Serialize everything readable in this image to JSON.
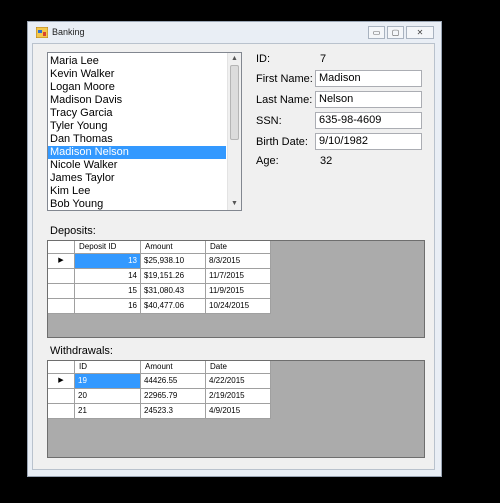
{
  "window": {
    "title": "Banking",
    "minimize": "▭",
    "maximize": "▢",
    "close": "✕"
  },
  "customers": {
    "items": [
      "Maria Lee",
      "Kevin Walker",
      "Logan Moore",
      "Madison Davis",
      "Tracy Garcia",
      "Tyler Young",
      "Dan Thomas",
      "Madison Nelson",
      "Nicole Walker",
      "James Taylor",
      "Kim Lee",
      "Bob Young"
    ],
    "selected_index": 7
  },
  "details": {
    "id_label": "ID:",
    "id_value": "7",
    "first_name_label": "First Name:",
    "first_name_value": "Madison",
    "last_name_label": "Last Name:",
    "last_name_value": "Nelson",
    "ssn_label": "SSN:",
    "ssn_value": "635-98-4609",
    "birth_date_label": "Birth Date:",
    "birth_date_value": "9/10/1982",
    "age_label": "Age:",
    "age_value": "32"
  },
  "deposits": {
    "label": "Deposits:",
    "columns": [
      "Deposit ID",
      "Amount",
      "Date"
    ],
    "rows": [
      [
        "13",
        "$25,938.10",
        "8/3/2015"
      ],
      [
        "14",
        "$19,151.26",
        "11/7/2015"
      ],
      [
        "15",
        "$31,080.43",
        "11/9/2015"
      ],
      [
        "16",
        "$40,477.06",
        "10/24/2015"
      ]
    ]
  },
  "withdrawals": {
    "label": "Withdrawals:",
    "columns": [
      "ID",
      "Amount",
      "Date"
    ],
    "rows": [
      [
        "19",
        "44426.55",
        "4/22/2015"
      ],
      [
        "20",
        "22965.79",
        "2/19/2015"
      ],
      [
        "21",
        "24523.3",
        "4/9/2015"
      ]
    ]
  },
  "colors": {
    "selection": "#3399ff",
    "grid_background": "#ababab"
  },
  "icons": {
    "current_row": "▶",
    "scroll_up": "▲",
    "scroll_down": "▼"
  }
}
